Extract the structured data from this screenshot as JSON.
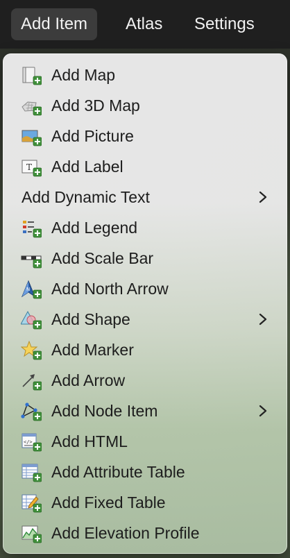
{
  "menubar": {
    "items": [
      {
        "label": "Add Item"
      },
      {
        "label": "Atlas"
      },
      {
        "label": "Settings"
      }
    ]
  },
  "menu": {
    "items": [
      {
        "label": "Add Map",
        "icon": "map-icon"
      },
      {
        "label": "Add 3D Map",
        "icon": "3d-map-icon"
      },
      {
        "label": "Add Picture",
        "icon": "picture-icon"
      },
      {
        "label": "Add Label",
        "icon": "label-icon"
      },
      {
        "label": "Add Dynamic Text",
        "submenu": true
      },
      {
        "label": "Add Legend",
        "icon": "legend-icon"
      },
      {
        "label": "Add Scale Bar",
        "icon": "scale-bar-icon"
      },
      {
        "label": "Add North Arrow",
        "icon": "north-arrow-icon"
      },
      {
        "label": "Add Shape",
        "icon": "shape-icon",
        "submenu": true
      },
      {
        "label": "Add Marker",
        "icon": "marker-icon"
      },
      {
        "label": "Add Arrow",
        "icon": "arrow-icon"
      },
      {
        "label": "Add Node Item",
        "icon": "node-item-icon",
        "submenu": true
      },
      {
        "label": "Add HTML",
        "icon": "html-icon"
      },
      {
        "label": "Add Attribute Table",
        "icon": "attribute-table-icon"
      },
      {
        "label": "Add Fixed Table",
        "icon": "fixed-table-icon"
      },
      {
        "label": "Add Elevation Profile",
        "icon": "elevation-profile-icon"
      }
    ]
  }
}
